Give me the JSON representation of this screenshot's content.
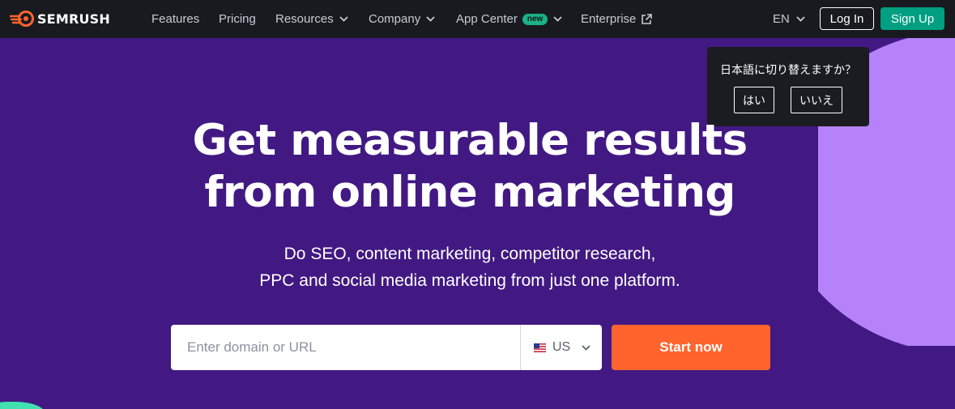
{
  "brand": {
    "name": "SEMRUSH",
    "logo_color": "#ff642d"
  },
  "nav": {
    "items": [
      {
        "label": "Features"
      },
      {
        "label": "Pricing"
      },
      {
        "label": "Resources",
        "icon": "chevron-down-icon"
      },
      {
        "label": "Company",
        "icon": "chevron-down-icon"
      },
      {
        "label": "App Center",
        "badge": "new",
        "icon": "chevron-down-icon"
      },
      {
        "label": "Enterprise",
        "icon": "external-link-icon"
      }
    ],
    "language": "EN",
    "login_label": "Log In",
    "signup_label": "Sign Up"
  },
  "language_prompt": {
    "question": "日本語に切り替えますか？",
    "yes_label": "はい",
    "no_label": "いいえ"
  },
  "hero": {
    "headline_line1": "Get measurable results",
    "headline_line2": "from online marketing",
    "subtitle_line1": "Do SEO, content marketing, competitor research,",
    "subtitle_line2": "PPC and social media marketing from just one platform.",
    "search_placeholder": "Enter domain or URL",
    "country": "US",
    "country_flag_icon": "us-flag-icon",
    "cta_label": "Start now"
  },
  "colors": {
    "nav_bg": "#181a1f",
    "hero_bg": "#421983",
    "accent_orange": "#ff642d",
    "signup_green": "#009f81",
    "decor_purple": "#b582fa",
    "decor_mint": "#40e0b0"
  }
}
